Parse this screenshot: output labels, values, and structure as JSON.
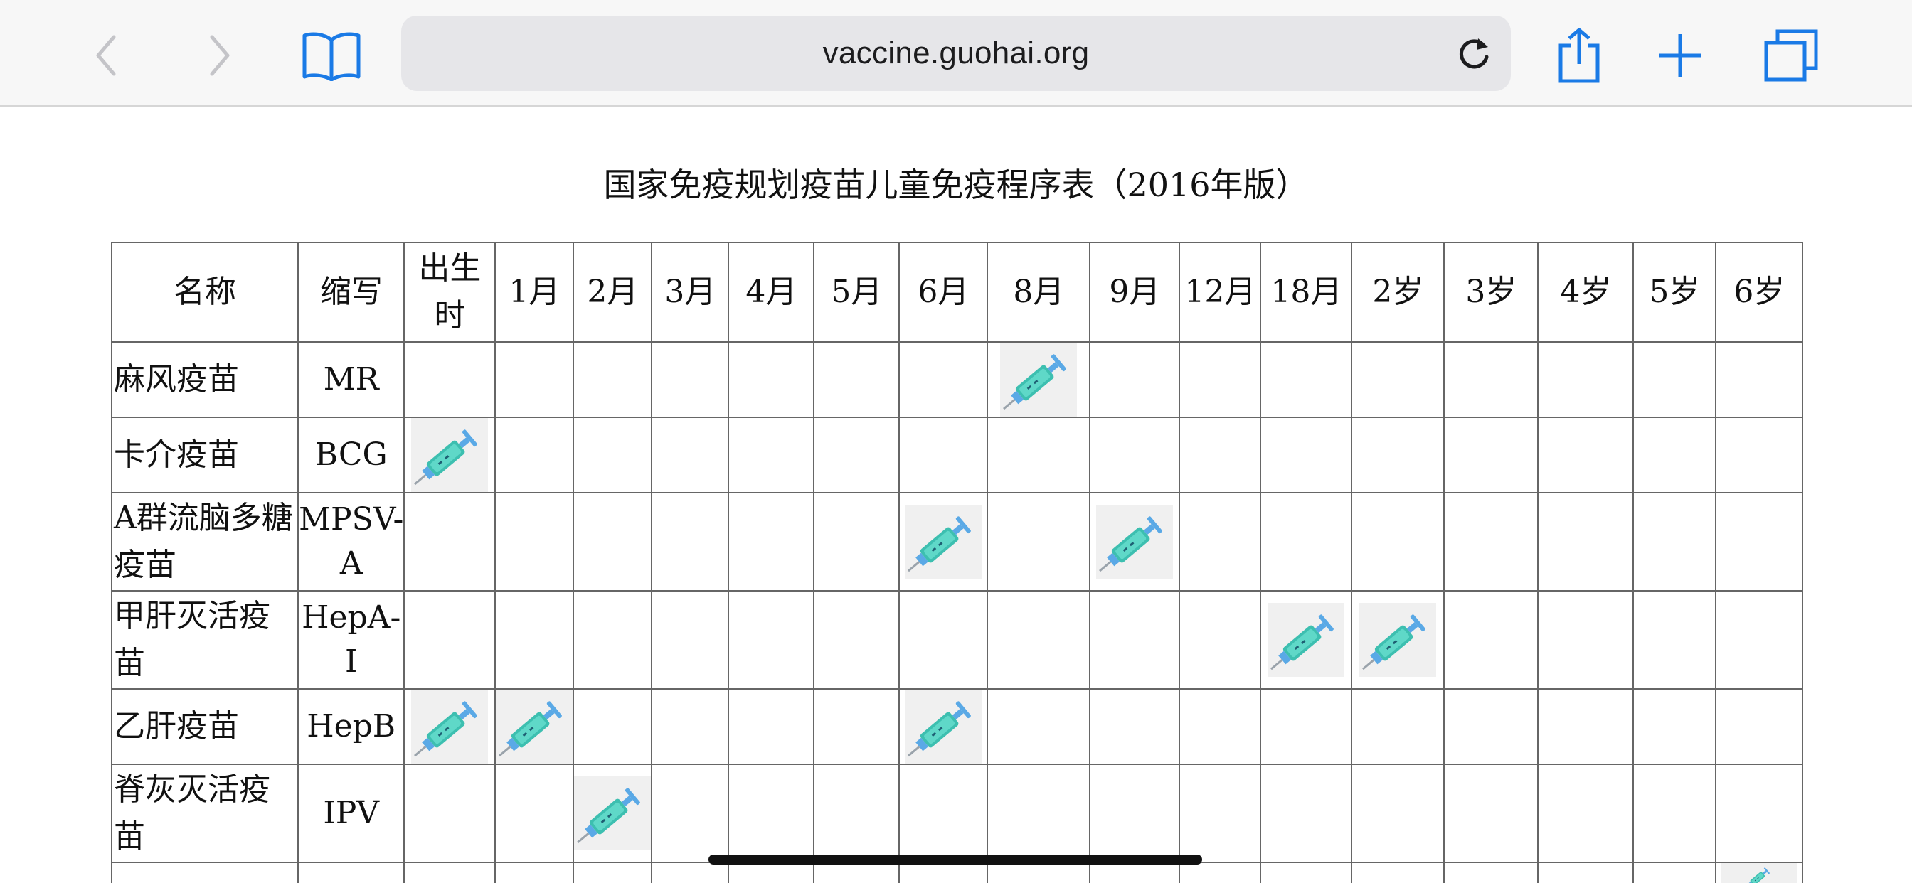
{
  "browser": {
    "url": "vaccine.guohai.org",
    "icons": {
      "back": "chevron-left-icon",
      "forward": "chevron-right-icon",
      "bookmarks": "book-icon",
      "reload": "reload-icon",
      "share": "share-icon",
      "new_tab": "plus-icon",
      "tabs": "tabs-icon"
    },
    "accent_color": "#1a7ae6"
  },
  "page": {
    "title": "国家免疫规划疫苗儿童免疫程序表（2016年版）",
    "table": {
      "headers": [
        "名称",
        "缩写",
        "出生时",
        "1月",
        "2月",
        "3月",
        "4月",
        "5月",
        "6月",
        "8月",
        "9月",
        "12月",
        "18月",
        "2岁",
        "3岁",
        "4岁",
        "5岁",
        "6岁"
      ],
      "rows": [
        {
          "name": "麻风疫苗",
          "abbr": "MR",
          "doses": [
            "8月"
          ]
        },
        {
          "name": "卡介疫苗",
          "abbr": "BCG",
          "doses": [
            "出生时"
          ]
        },
        {
          "name": "A群流脑多糖疫苗",
          "abbr": "MPSV-A",
          "doses": [
            "6月",
            "9月"
          ]
        },
        {
          "name": "甲肝灭活疫苗",
          "abbr": "HepA-I",
          "doses": [
            "18月",
            "2岁"
          ]
        },
        {
          "name": "乙肝疫苗",
          "abbr": "HepB",
          "doses": [
            "出生时",
            "1月",
            "6月"
          ]
        },
        {
          "name": "脊灰灭活疫苗",
          "abbr": "IPV",
          "doses": [
            "2月"
          ]
        },
        {
          "name": "",
          "abbr": "",
          "doses": [
            "6岁"
          ]
        }
      ],
      "dose_icon": "syringe-icon",
      "dose_color": "#3dbfb0"
    }
  }
}
